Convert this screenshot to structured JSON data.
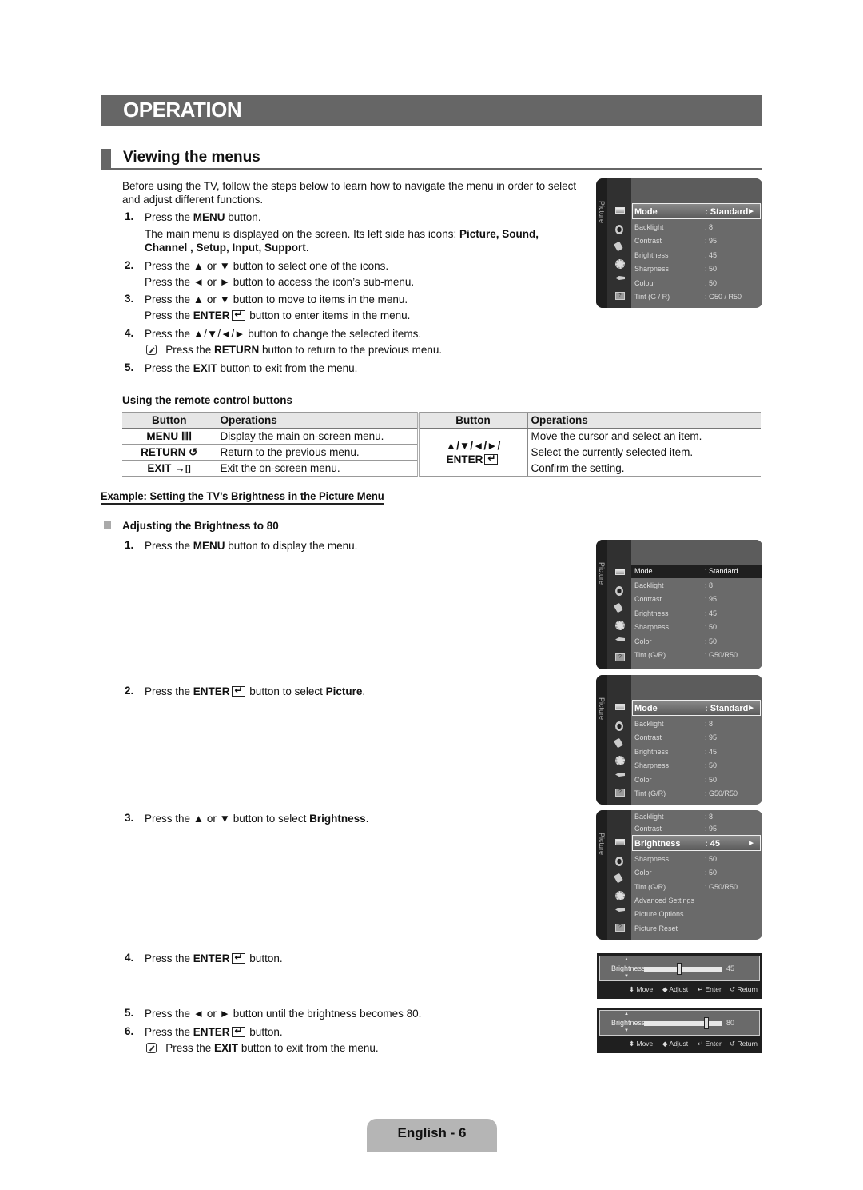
{
  "banner": {
    "title": "OPERATION"
  },
  "section": {
    "title": "Viewing the menus"
  },
  "intro": {
    "line1": "Before using the TV, follow the steps below to learn how to navigate the menu in order to select",
    "line2": "and adjust different functions."
  },
  "steps": [
    {
      "num": "1.",
      "pre": "Press the ",
      "bold": "MENU",
      "post": " button."
    },
    {
      "sub1_pre": "The main menu is displayed on the screen. Its left side has icons: ",
      "sub1_bold": "Picture, Sound,",
      "sub2_bold": "Channel , Setup, Input, Support",
      "sub2_post": "."
    },
    {
      "num": "2.",
      "text": "Press the ▲ or ▼ button to select one of the icons.",
      "sub": "Press the ◄ or ► button to access the icon’s sub-menu."
    },
    {
      "num": "3.",
      "text": "Press the ▲ or ▼ button to move to items in the menu.",
      "sub_pre": "Press the ",
      "sub_bold": "ENTER",
      "sub_post": " button to enter items in the menu."
    },
    {
      "num": "4.",
      "text": "Press the ▲/▼/◄/► button to change the selected items.",
      "note_pre": "Press the ",
      "note_bold": "RETURN",
      "note_post": " button to return to the previous menu."
    },
    {
      "num": "5.",
      "pre": "Press the ",
      "bold": "EXIT",
      "post": " button to exit from the menu."
    }
  ],
  "remote": {
    "heading": "Using the remote control buttons",
    "headers": [
      "Button",
      "Operations",
      "Button",
      "Operations"
    ],
    "left_rows": [
      {
        "button": "MENU ⅢⅠ",
        "op": "Display the main on-screen menu."
      },
      {
        "button": "RETURN ↺",
        "op": "Return to the previous menu."
      },
      {
        "button": "EXIT →▯",
        "op": "Exit the on-screen menu."
      }
    ],
    "right_button_line1": "▲/▼/◄/►/",
    "right_button_line2": "ENTER",
    "right_ops": [
      "Move the cursor and select an item.",
      "Select the currently selected item.",
      "Confirm the setting."
    ]
  },
  "example": {
    "title": "Example: Setting the TV’s Brightness in the Picture Menu",
    "subheading": "Adjusting the Brightness to 80",
    "steps": [
      {
        "num": "1.",
        "pre": "Press the ",
        "bold": "MENU",
        "post": " button to display the menu."
      },
      {
        "num": "2.",
        "pre": "Press the ",
        "bold": "ENTER",
        "post": " button to select ",
        "bold2": "Picture",
        "post2": "."
      },
      {
        "num": "3.",
        "pre": "Press the ▲ or ▼ button to select ",
        "bold": "Brightness",
        "post": "."
      },
      {
        "num": "4.",
        "pre": "Press the ",
        "bold": "ENTER",
        "post": " button."
      },
      {
        "num": "5.",
        "text": "Press the ◄ or ► button until the brightness becomes 80."
      },
      {
        "num": "6.",
        "pre": "Press the ",
        "bold": "ENTER",
        "post": " button."
      },
      {
        "note_pre": "Press the ",
        "note_bold": "EXIT",
        "note_post": " button to exit from the menu."
      }
    ]
  },
  "tv_menus": {
    "side_label": "Picture",
    "menu1": [
      {
        "k": "Mode",
        "v": ": Standard"
      },
      {
        "k": "Backlight",
        "v": ": 8"
      },
      {
        "k": "Contrast",
        "v": ": 95"
      },
      {
        "k": "Brightness",
        "v": ": 45"
      },
      {
        "k": "Sharpness",
        "v": ": 50"
      },
      {
        "k": "Colour",
        "v": ": 50"
      },
      {
        "k": "Tint (G / R)",
        "v": ": G50 / R50"
      }
    ],
    "menu2": [
      {
        "k": "Mode",
        "v": ": Standard"
      },
      {
        "k": "Backlight",
        "v": ": 8"
      },
      {
        "k": "Contrast",
        "v": ": 95"
      },
      {
        "k": "Brightness",
        "v": ": 45"
      },
      {
        "k": "Sharpness",
        "v": ": 50"
      },
      {
        "k": "Color",
        "v": ": 50"
      },
      {
        "k": "Tint (G/R)",
        "v": ": G50/R50"
      }
    ],
    "menu4": [
      {
        "k": "Backlight",
        "v": ": 8"
      },
      {
        "k": "Contrast",
        "v": ": 95"
      },
      {
        "k": "Brightness",
        "v": ": 45"
      },
      {
        "k": "Sharpness",
        "v": ": 50"
      },
      {
        "k": "Color",
        "v": ": 50"
      },
      {
        "k": "Tint (G/R)",
        "v": ": G50/R50"
      },
      {
        "k": "Advanced Settings",
        "v": ""
      },
      {
        "k": "Picture Options",
        "v": ""
      },
      {
        "k": "Picture Reset",
        "v": ""
      }
    ],
    "arrow": "►"
  },
  "sliders": [
    {
      "label": "Brightness",
      "value": "45",
      "fraction": 0.45
    },
    {
      "label": "Brightness",
      "value": "80",
      "fraction": 0.8
    }
  ],
  "slider_help": {
    "move": "⬍ Move",
    "adjust": "◆ Adjust",
    "enter": "↵ Enter",
    "return": "↺ Return"
  },
  "footer": {
    "page": "English - 6"
  }
}
